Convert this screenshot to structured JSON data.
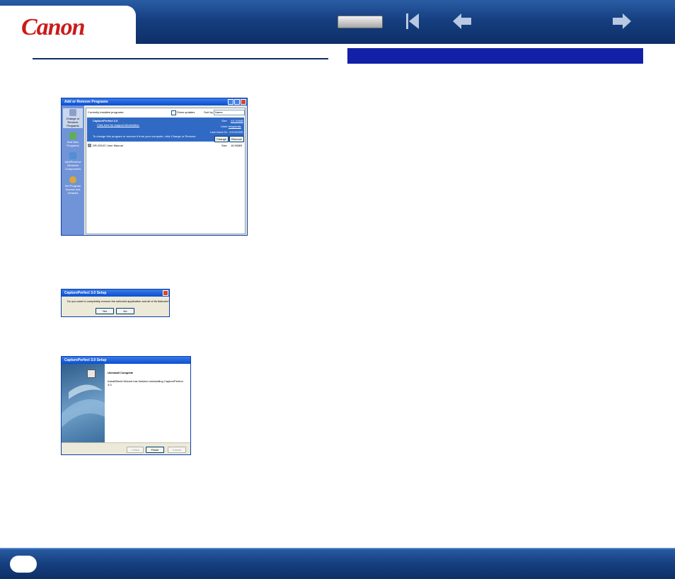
{
  "header": {
    "brand": "Canon",
    "colors": {
      "brand_red": "#cc1a1a",
      "header_blue": "#163f80",
      "title_bar_blue": "#1220a8"
    },
    "icons": [
      "canon-logo",
      "contents-button",
      "first-page-icon",
      "back-arrow-icon",
      "forward-arrow-icon"
    ]
  },
  "screen1": {
    "title": "Add or Remove Programs",
    "sidebar": [
      {
        "label": "Change or Remove Programs"
      },
      {
        "label": "Add New Programs"
      },
      {
        "label": "Add/Remove Windows Components"
      },
      {
        "label": "Set Program Access and Defaults"
      }
    ],
    "currently_installed": "Currently installed programs:",
    "show_updates": "Show updates",
    "sort_by": "Sort by:",
    "sort_value": "Name",
    "selected": {
      "name": "CapturePerfect 3.0",
      "support": "Click here for support information.",
      "size_label": "Size",
      "size_value": "XX.XXMB",
      "used_label": "Used",
      "used_value": "frequently",
      "last_used_label": "Last Used On",
      "last_used_value": "X/XX/2009",
      "instruction": "To change this program or remove it from your computer, click Change or Remove.",
      "change": "Change",
      "remove": "Remove"
    },
    "other": {
      "name": "DR-2510C User Manual",
      "size_label": "Size",
      "size_value": "16.90MB"
    }
  },
  "screen2": {
    "title": "CapturePerfect 3.0 Setup",
    "question": "Do you want to completely remove the selected application and all of its features?",
    "yes": "Yes",
    "no": "No"
  },
  "screen3": {
    "title": "CapturePerfect 3.0 Setup",
    "heading": "Uninstall Complete",
    "message": "InstallShield Wizard has finished uninstalling CapturePerfect 3.0.",
    "back": "< Back",
    "finish": "Finish",
    "cancel": "Cancel"
  }
}
